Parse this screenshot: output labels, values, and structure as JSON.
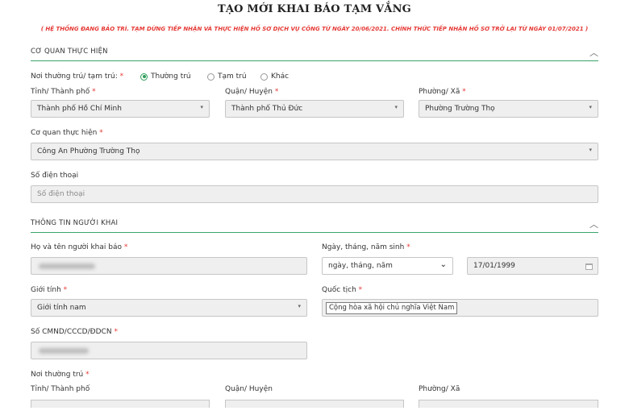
{
  "page": {
    "title": "TẠO MỚI KHAI BÁO TẠM VẮNG",
    "notice": "( HỆ THỐNG ĐANG BẢO TRÌ. TẠM DỪNG TIẾP NHẬN VÀ THỰC HIỆN HỒ SƠ DỊCH VỤ CÔNG TỪ NGÀY 20/06/2021. CHÍNH THỨC TIẾP NHẬN HỒ SƠ TRỞ LẠI TỪ NGÀY 01/07/2021 )"
  },
  "agency_section": {
    "header": "CƠ QUAN THỰC HIỆN",
    "residence_type_label": "Nơi thường trú/ tạm trú:",
    "residence_options": [
      "Thường trú",
      "Tạm trú",
      "Khác"
    ],
    "selected_option": "Thường trú",
    "province_label": "Tỉnh/ Thành phố",
    "province_value": "Thành phố Hồ Chí Minh",
    "district_label": "Quận/ Huyện",
    "district_value": "Thành phố Thủ Đức",
    "ward_label": "Phường/ Xã",
    "ward_value": "Phường Trường Thọ",
    "agency_label": "Cơ quan thực hiện",
    "agency_value": "Công An Phường Trường Thọ",
    "phone_label": "Số điện thoại",
    "phone_placeholder": "Số điện thoại"
  },
  "declarant_section": {
    "header": "THÔNG TIN NGƯỜI KHAI",
    "fullname_label": "Họ và tên người khai báo",
    "dob_label": "Ngày, tháng, năm sinh",
    "dob_format_value": "ngày, tháng, năm",
    "dob_value": "17/01/1999",
    "gender_label": "Giới tính",
    "gender_value": "Giới tính nam",
    "nationality_label": "Quốc tịch",
    "nationality_value": "Cộng hòa xã hội chủ nghĩa Việt Nam",
    "id_label": "Số CMND/CCCD/ĐDCN",
    "permanent_label": "Nơi thường trú",
    "province_label": "Tỉnh/ Thành phố",
    "district_label": "Quận/ Huyện",
    "ward_label": "Phường/ Xã"
  },
  "icons": {
    "collapse": "chevron-up-icon",
    "dropdown": "caret-down-icon",
    "calendar": "calendar-icon"
  },
  "colors": {
    "accent": "#3aa56b",
    "required": "#e53935",
    "field_bg": "#efefef"
  }
}
